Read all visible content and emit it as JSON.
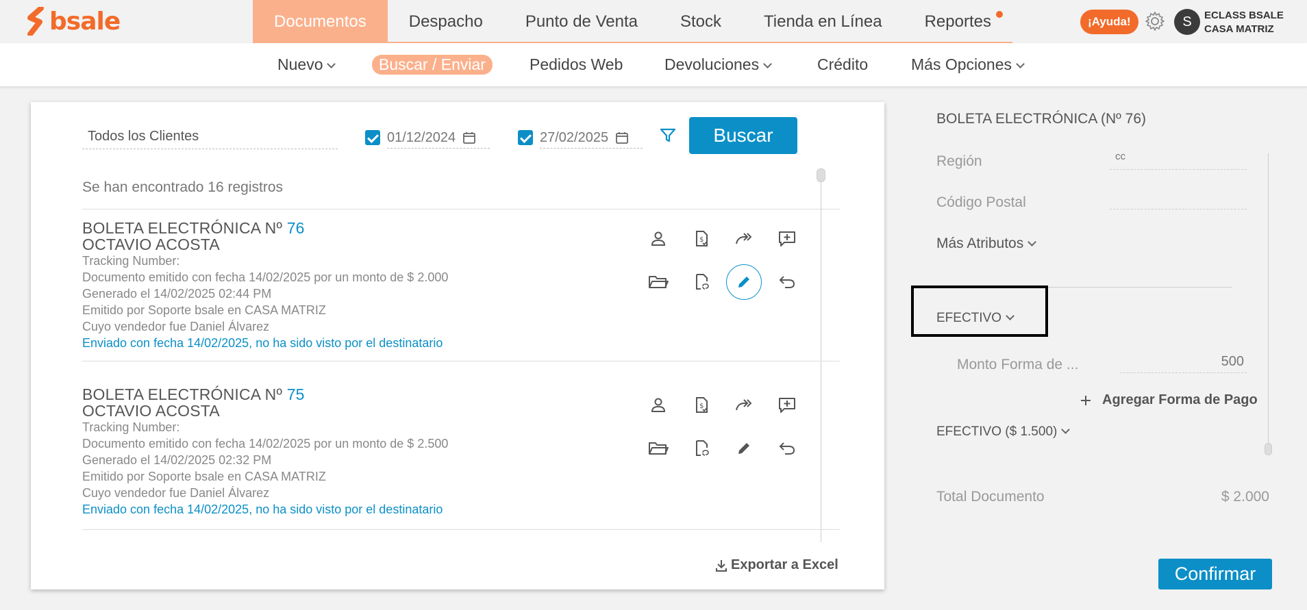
{
  "brand": {
    "name": "bsale",
    "color": "#f26b2a"
  },
  "main_nav": [
    {
      "label": "Documentos",
      "active": true
    },
    {
      "label": "Despacho"
    },
    {
      "label": "Punto de Venta"
    },
    {
      "label": "Stock"
    },
    {
      "label": "Tienda en Línea"
    },
    {
      "label": "Reportes",
      "dot": true
    }
  ],
  "header": {
    "help_label": "¡Ayuda!",
    "avatar_initial": "S",
    "account_line1": "ECLASS BSALE",
    "account_line2": "CASA MATRIZ"
  },
  "sub_nav": [
    {
      "label": "Nuevo",
      "dropdown": true
    },
    {
      "label": "Buscar / Enviar",
      "active": true
    },
    {
      "label": "Pedidos Web"
    },
    {
      "label": "Devoluciones",
      "dropdown": true
    },
    {
      "label": "Crédito"
    },
    {
      "label": "Más Opciones",
      "dropdown": true
    }
  ],
  "search": {
    "client_value": "Todos los Clientes",
    "date_from": "01/12/2024",
    "date_to": "27/02/2025",
    "date_from_checked": true,
    "date_to_checked": true,
    "button_label": "Buscar",
    "results_text": "Se han encontrado 16 registros"
  },
  "documents": [
    {
      "title": "BOLETA ELECTRÓNICA Nº",
      "number": "76",
      "client": "OCTAVIO ACOSTA",
      "tracking": "Tracking Number:",
      "issued": "Documento emitido con fecha 14/02/2025 por un monto de $ 2.000",
      "generated": "Generado el 14/02/2025 02:44 PM",
      "emitted_by": "Emitido por Soporte bsale en CASA MATRIZ",
      "seller": "Cuyo vendedor fue Daniel Álvarez",
      "sent": "Enviado con fecha 14/02/2025, no ha sido visto por el destinatario",
      "edit_highlighted": true
    },
    {
      "title": "BOLETA ELECTRÓNICA Nº",
      "number": "75",
      "client": "OCTAVIO ACOSTA",
      "tracking": "Tracking Number:",
      "issued": "Documento emitido con fecha 14/02/2025 por un monto de $ 2.500",
      "generated": "Generado el 14/02/2025 02:32 PM",
      "emitted_by": "Emitido por Soporte bsale en CASA MATRIZ",
      "seller": "Cuyo vendedor fue Daniel Álvarez",
      "sent": "Enviado con fecha 14/02/2025, no ha sido visto por el destinatario",
      "edit_highlighted": false
    }
  ],
  "export_label": "Exportar a Excel",
  "panel": {
    "title": "BOLETA ELECTRÓNICA (Nº 76)",
    "region_label": "Región",
    "region_value": "cc",
    "postal_label": "Código Postal",
    "postal_value": "",
    "more_attrs_label": "Más Atributos",
    "payment_method": "EFECTIVO",
    "amount_label": "Monto Forma de ...",
    "amount_value": "500",
    "add_payment_label": "Agregar Forma de Pago",
    "payment_summary": "EFECTIVO ($ 1.500)",
    "total_label": "Total Documento",
    "total_value": "$ 2.000",
    "confirm_label": "Confirmar"
  },
  "colors": {
    "accent": "#0c8fc7",
    "brand_soft": "#fbb08c",
    "brand": "#f26b2a"
  }
}
